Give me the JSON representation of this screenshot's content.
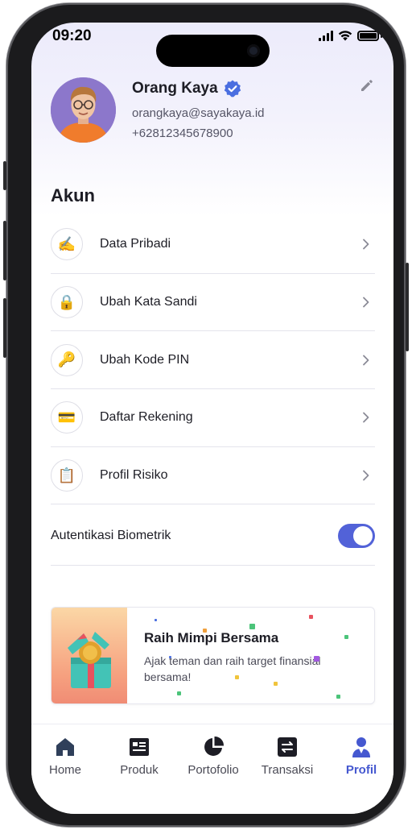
{
  "status_bar": {
    "time": "09:20"
  },
  "profile": {
    "name": "Orang Kaya",
    "email": "orangkaya@sayakaya.id",
    "phone": "+62812345678900"
  },
  "account_section": {
    "title": "Akun",
    "items": [
      {
        "label": "Data Pribadi",
        "icon": "writing-hand-icon"
      },
      {
        "label": "Ubah Kata Sandi",
        "icon": "lock-icon"
      },
      {
        "label": "Ubah Kode PIN",
        "icon": "key-icon"
      },
      {
        "label": "Daftar Rekening",
        "icon": "credit-card-icon"
      },
      {
        "label": "Profil Risiko",
        "icon": "clipboard-icon"
      }
    ],
    "biometric": {
      "label": "Autentikasi Biometrik",
      "enabled": true
    }
  },
  "promo": {
    "title": "Raih Mimpi Bersama",
    "description": "Ajak teman dan raih target finansial bersama!"
  },
  "tab_bar": {
    "tabs": [
      {
        "label": "Home",
        "icon": "home-icon",
        "active": false
      },
      {
        "label": "Produk",
        "icon": "product-card-icon",
        "active": false
      },
      {
        "label": "Portofolio",
        "icon": "pie-chart-icon",
        "active": false
      },
      {
        "label": "Transaksi",
        "icon": "transfer-icon",
        "active": false
      },
      {
        "label": "Profil",
        "icon": "person-icon",
        "active": true
      }
    ]
  },
  "colors": {
    "accent": "#4558d0",
    "toggle_on": "#5262d8",
    "text_primary": "#1d1d25"
  }
}
